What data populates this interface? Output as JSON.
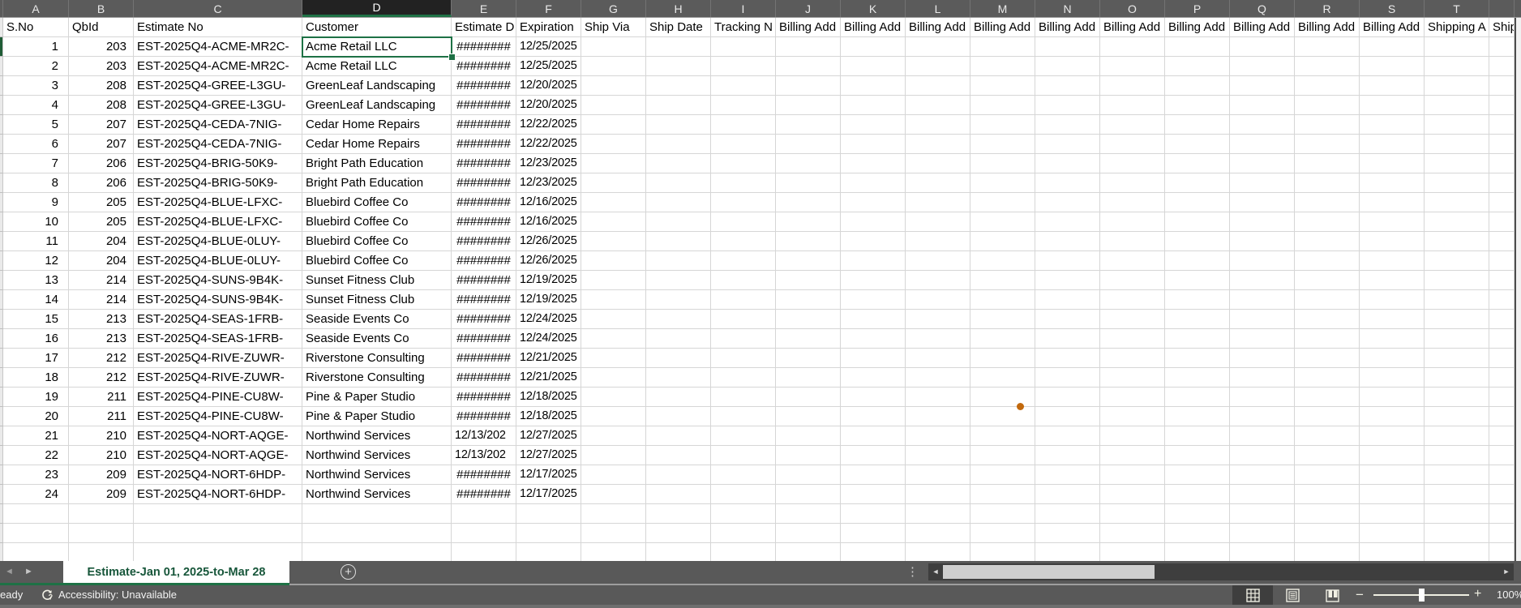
{
  "columns": [
    {
      "letter": "A",
      "header": "S.No"
    },
    {
      "letter": "B",
      "header": "QbId"
    },
    {
      "letter": "C",
      "header": "Estimate No"
    },
    {
      "letter": "D",
      "header": "Customer",
      "selected": true
    },
    {
      "letter": "E",
      "header": "Estimate D"
    },
    {
      "letter": "F",
      "header": "Expiration"
    },
    {
      "letter": "G",
      "header": "Ship Via"
    },
    {
      "letter": "H",
      "header": "Ship Date"
    },
    {
      "letter": "I",
      "header": "Tracking N"
    },
    {
      "letter": "J",
      "header": "Billing Add"
    },
    {
      "letter": "K",
      "header": "Billing Add"
    },
    {
      "letter": "L",
      "header": "Billing Add"
    },
    {
      "letter": "M",
      "header": "Billing Add"
    },
    {
      "letter": "N",
      "header": "Billing Add"
    },
    {
      "letter": "O",
      "header": "Billing Add"
    },
    {
      "letter": "P",
      "header": "Billing Add"
    },
    {
      "letter": "Q",
      "header": "Billing Add"
    },
    {
      "letter": "R",
      "header": "Billing Add"
    },
    {
      "letter": "S",
      "header": "Billing Add"
    },
    {
      "letter": "T",
      "header": "Shipping A"
    },
    {
      "letter": "",
      "header": "Ship"
    }
  ],
  "rows": [
    [
      "1",
      "203",
      "EST-2025Q4-ACME-MR2C-",
      "Acme Retail LLC",
      "########",
      "12/25/2025"
    ],
    [
      "2",
      "203",
      "EST-2025Q4-ACME-MR2C-",
      "Acme Retail LLC",
      "########",
      "12/25/2025"
    ],
    [
      "3",
      "208",
      "EST-2025Q4-GREE-L3GU-",
      "GreenLeaf Landscaping",
      "########",
      "12/20/2025"
    ],
    [
      "4",
      "208",
      "EST-2025Q4-GREE-L3GU-",
      "GreenLeaf Landscaping",
      "########",
      "12/20/2025"
    ],
    [
      "5",
      "207",
      "EST-2025Q4-CEDA-7NIG-",
      "Cedar Home Repairs",
      "########",
      "12/22/2025"
    ],
    [
      "6",
      "207",
      "EST-2025Q4-CEDA-7NIG-",
      "Cedar Home Repairs",
      "########",
      "12/22/2025"
    ],
    [
      "7",
      "206",
      "EST-2025Q4-BRIG-50K9-",
      "Bright Path Education",
      "########",
      "12/23/2025"
    ],
    [
      "8",
      "206",
      "EST-2025Q4-BRIG-50K9-",
      "Bright Path Education",
      "########",
      "12/23/2025"
    ],
    [
      "9",
      "205",
      "EST-2025Q4-BLUE-LFXC-",
      "Bluebird Coffee Co",
      "########",
      "12/16/2025"
    ],
    [
      "10",
      "205",
      "EST-2025Q4-BLUE-LFXC-",
      "Bluebird Coffee Co",
      "########",
      "12/16/2025"
    ],
    [
      "11",
      "204",
      "EST-2025Q4-BLUE-0LUY-",
      "Bluebird Coffee Co",
      "########",
      "12/26/2025"
    ],
    [
      "12",
      "204",
      "EST-2025Q4-BLUE-0LUY-",
      "Bluebird Coffee Co",
      "########",
      "12/26/2025"
    ],
    [
      "13",
      "214",
      "EST-2025Q4-SUNS-9B4K-",
      "Sunset Fitness Club",
      "########",
      "12/19/2025"
    ],
    [
      "14",
      "214",
      "EST-2025Q4-SUNS-9B4K-",
      "Sunset Fitness Club",
      "########",
      "12/19/2025"
    ],
    [
      "15",
      "213",
      "EST-2025Q4-SEAS-1FRB-",
      "Seaside Events Co",
      "########",
      "12/24/2025"
    ],
    [
      "16",
      "213",
      "EST-2025Q4-SEAS-1FRB-",
      "Seaside Events Co",
      "########",
      "12/24/2025"
    ],
    [
      "17",
      "212",
      "EST-2025Q4-RIVE-ZUWR-",
      "Riverstone Consulting",
      "########",
      "12/21/2025"
    ],
    [
      "18",
      "212",
      "EST-2025Q4-RIVE-ZUWR-",
      "Riverstone Consulting",
      "########",
      "12/21/2025"
    ],
    [
      "19",
      "211",
      "EST-2025Q4-PINE-CU8W-",
      "Pine & Paper Studio",
      "########",
      "12/18/2025"
    ],
    [
      "20",
      "211",
      "EST-2025Q4-PINE-CU8W-",
      "Pine & Paper Studio",
      "########",
      "12/18/2025"
    ],
    [
      "21",
      "210",
      "EST-2025Q4-NORT-AQGE-",
      "Northwind Services",
      "12/13/202",
      "12/27/2025"
    ],
    [
      "22",
      "210",
      "EST-2025Q4-NORT-AQGE-",
      "Northwind Services",
      "12/13/202",
      "12/27/2025"
    ],
    [
      "23",
      "209",
      "EST-2025Q4-NORT-6HDP-",
      "Northwind Services",
      "########",
      "12/17/2025"
    ],
    [
      "24",
      "209",
      "EST-2025Q4-NORT-6HDP-",
      "Northwind Services",
      "########",
      "12/17/2025"
    ]
  ],
  "selection": {
    "active_cell": "D2",
    "active_column": "D"
  },
  "sheet_tabs": {
    "active_tab": "Estimate-Jan 01, 2025-to-Mar 28",
    "add_label": "+",
    "prev_arrow": "◄",
    "next_arrow": "►"
  },
  "hscrollbar": {
    "left_arrow": "◄",
    "right_arrow": "►",
    "dots": "⋮"
  },
  "status_bar": {
    "ready_label": "eady",
    "accessibility_label": "Accessibility: Unavailable",
    "zoom_minus": "−",
    "zoom_plus": "+",
    "zoom_percent": "100%"
  },
  "colors": {
    "accent_green": "#1e7145",
    "tab_text_green": "#17563a",
    "header_gray": "#5b5b5b",
    "selected_header": "#222222",
    "status_gray": "#595959",
    "gridline": "#d6d6d6",
    "cursor_dot_orange": "#c2690d"
  }
}
